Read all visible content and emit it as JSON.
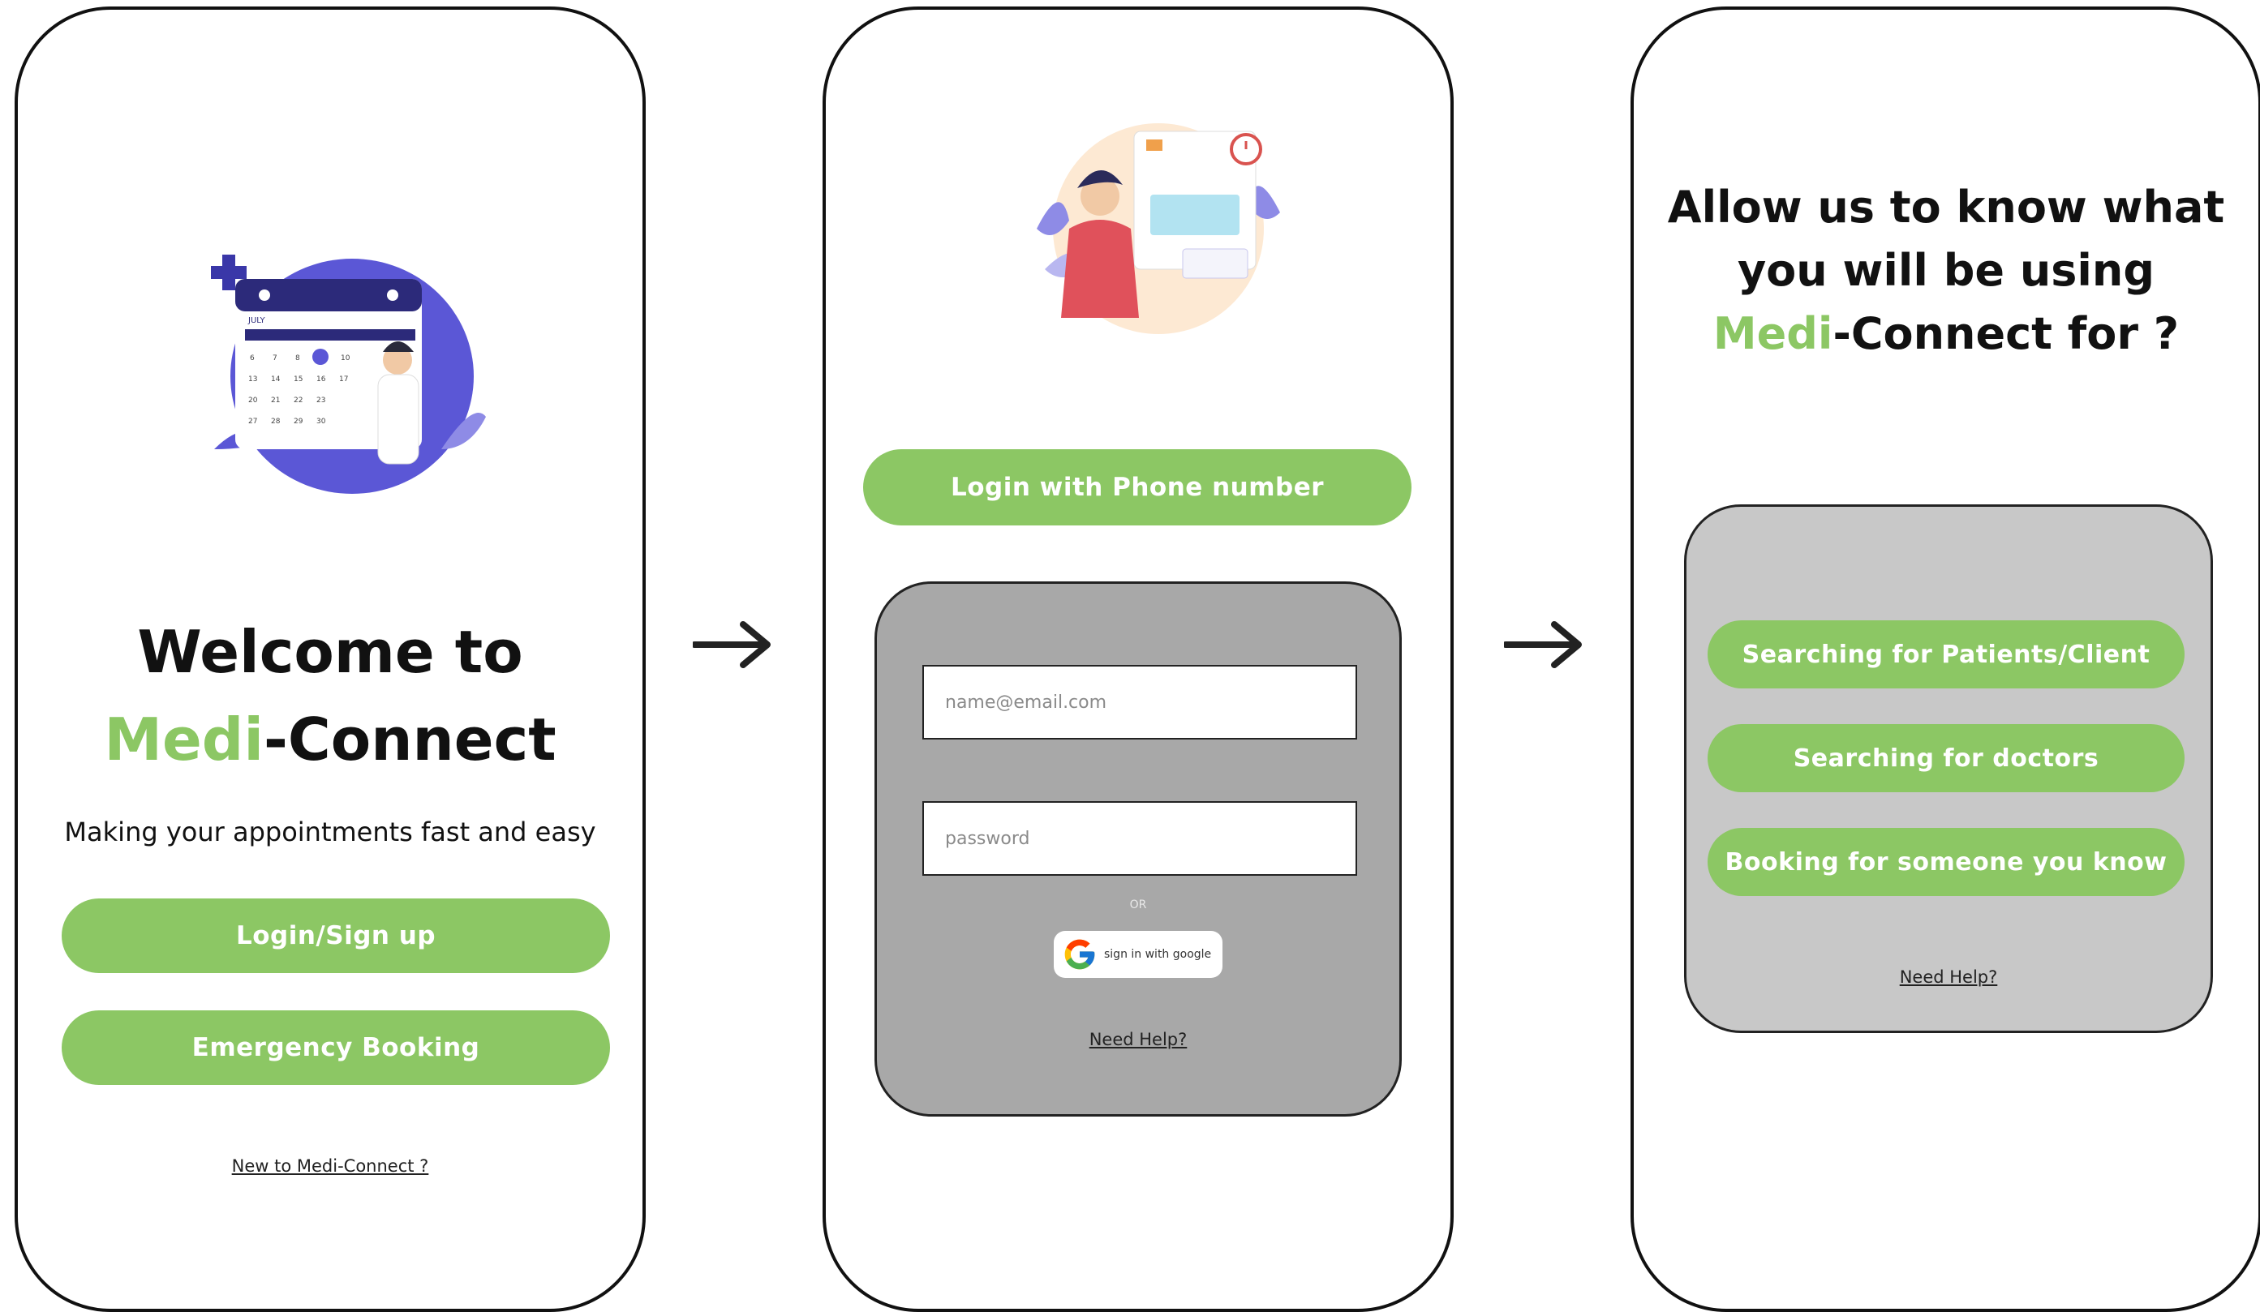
{
  "screen1": {
    "welcome_line1": "Welcome to",
    "brand_green": "Medi",
    "brand_rest": "-Connect",
    "tagline": "Making your appointments fast and easy",
    "login_signup_label": "Login/Sign up",
    "emergency_label": "Emergency Booking",
    "new_user_link": "New to Medi-Connect ?",
    "calendar_month": "JULY"
  },
  "screen2": {
    "phone_login_label": "Login with Phone number",
    "email_placeholder": "name@email.com",
    "password_placeholder": "password",
    "or_label": "OR",
    "google_label": "sign in with google",
    "need_help": "Need Help?"
  },
  "screen3": {
    "question_line1": "Allow us to know what",
    "question_line2": "you will be using",
    "brand_green": "Medi",
    "question_line3_rest": "-Connect for ?",
    "options": [
      {
        "label": "Searching for Patients/Client"
      },
      {
        "label": "Searching for doctors"
      },
      {
        "label": "Booking for someone you know"
      }
    ],
    "need_help": "Need Help?"
  },
  "colors": {
    "accent": "#8cc764",
    "card_gray_dark": "#a8a8a8",
    "card_gray_light": "#c8c8c8",
    "illustration_purple": "#5b57d6"
  },
  "icons": {
    "arrow": "right-arrow-icon",
    "google": "google-g-icon"
  }
}
